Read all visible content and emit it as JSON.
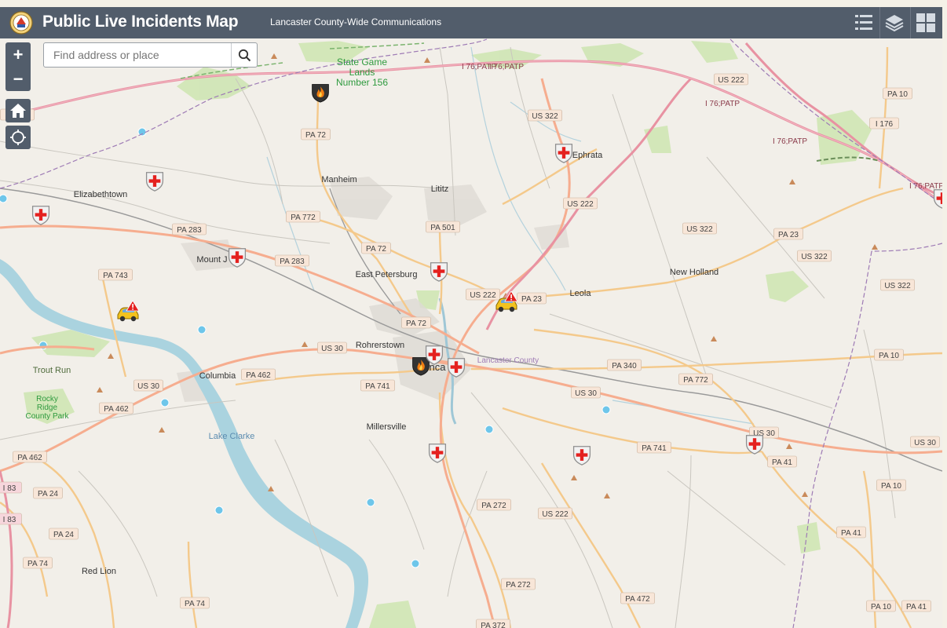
{
  "header": {
    "title": "Public Live Incidents Map",
    "subtitle": "Lancaster County-Wide Communications",
    "logo_icon": "county-seal-icon",
    "buttons": [
      {
        "name": "legend-button",
        "icon": "list-icon"
      },
      {
        "name": "layers-button",
        "icon": "layers-icon"
      },
      {
        "name": "basemap-button",
        "icon": "grid-icon"
      }
    ],
    "color": "#525d6b"
  },
  "search": {
    "placeholder": "Find address or place",
    "value": ""
  },
  "controls": {
    "zoom_in": "+",
    "zoom_out": "−",
    "home_icon": "home-icon",
    "locate_icon": "locate-icon"
  },
  "map": {
    "place_labels": [
      "State Game Lands Number 156",
      "Manheim",
      "Lititz",
      "Ephrata",
      "Elizabethtown",
      "Mount J",
      "East Petersburg",
      "New Holland",
      "Leola",
      "Rohrerstown",
      "Columbia",
      "Trout Run",
      "Rocky Ridge County Park",
      "Millersville",
      "Lake Clarke",
      "Red Lion",
      "Lancaster County",
      "nca"
    ],
    "road_labels": [
      "I 76;PATP",
      "I 76;PATP",
      "I 76;PATP",
      "I 76;PATP",
      "I 76;PATP",
      "I 76;PATP",
      "US 222",
      "PA 10",
      "US 322",
      "I 176",
      "PA 72",
      "PA 283",
      "PA 772",
      "PA 501",
      "US 222",
      "PA 283",
      "PA 283",
      "PA 72",
      "US 322",
      "PA 23",
      "US 322",
      "PA 743",
      "PA 23",
      "US 222",
      "US 322",
      "PA 72",
      "US 30",
      "PA 340",
      "PA 10",
      "PA 462",
      "PA 741",
      "PA 772",
      "US 30",
      "PA 462",
      "US 30",
      "PA 741",
      "US 30",
      "PA 462",
      "PA 41",
      "US 30",
      "PA 24",
      "I 83",
      "I 83",
      "PA 272",
      "US 222",
      "PA 10",
      "PA 24",
      "PA 41",
      "PA 74",
      "PA 272",
      "PA 472",
      "PA 74",
      "PA 372",
      "PA 10",
      "PA 41"
    ],
    "incident_icons": [
      "fire-incident-icon",
      "fire-incident-icon",
      "traffic-accident-icon",
      "traffic-accident-icon",
      "medical-incident-icon",
      "medical-incident-icon",
      "medical-incident-icon",
      "medical-incident-icon",
      "medical-incident-icon",
      "medical-incident-icon",
      "medical-incident-icon",
      "medical-incident-icon",
      "medical-incident-icon",
      "medical-incident-icon",
      "medical-incident-icon"
    ],
    "colors": {
      "background": "#f2efe9",
      "water": "#aad3df",
      "park": "#cde5b5",
      "motorway": "#e892a2",
      "trunk": "#f9b29c",
      "primary": "#fcd6a4",
      "county_border": "#9e7bb5",
      "shield_fill": "#f6e0d6",
      "medical_red": "#e4211f"
    }
  }
}
